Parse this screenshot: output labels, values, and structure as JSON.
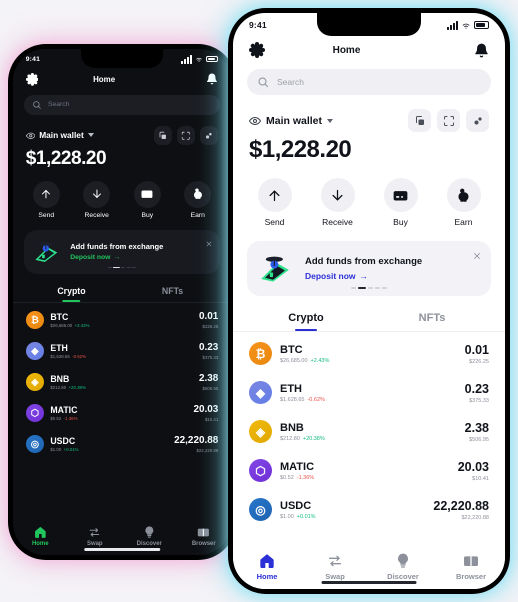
{
  "meta": {
    "accent_dark": "#21c55d",
    "accent_light": "#2a2fd6",
    "up_color": "#13bd7e",
    "down_color": "#e8524b",
    "glow_dark_phone": "#f0a0d2",
    "glow_light_phone": "#78dcf0"
  },
  "status_bar": {
    "time": "9:41",
    "signal_icon": "cellular-bars-icon",
    "wifi_icon": "wifi-icon",
    "battery_icon": "battery-icon"
  },
  "header": {
    "title": "Home",
    "settings_icon": "gear-icon",
    "notifications_icon": "bell-icon"
  },
  "search": {
    "placeholder": "Search",
    "icon": "search-icon"
  },
  "wallet": {
    "eye_icon": "eye-icon",
    "name": "Main wallet",
    "caret_icon": "chevron-down-icon",
    "balance": "$1,228.20",
    "actions": [
      {
        "name": "copy-address-button",
        "icon": "copy-icon"
      },
      {
        "name": "scan-qr-button",
        "icon": "scan-icon"
      },
      {
        "name": "connect-button",
        "icon": "link-icon"
      }
    ]
  },
  "quick_actions": [
    {
      "label": "Send",
      "icon": "arrow-up-icon"
    },
    {
      "label": "Receive",
      "icon": "arrow-down-icon"
    },
    {
      "label": "Buy",
      "icon": "card-icon"
    },
    {
      "label": "Earn",
      "icon": "piggy-bank-icon"
    }
  ],
  "promo": {
    "title": "Add funds from exchange",
    "cta": "Deposit now",
    "cta_arrow": "→",
    "close_icon": "close-icon",
    "illustration": "phone-with-coin-icon",
    "dots": 5,
    "active_dot": 1
  },
  "tabs": [
    {
      "label": "Crypto",
      "active": true
    },
    {
      "label": "NFTs",
      "active": false
    }
  ],
  "tokens": [
    {
      "symbol": "BTC",
      "price": "$26,685.00",
      "change": "+2.43%",
      "dir": "up",
      "amount": "0.01",
      "value": "$226.25",
      "color1": "#f7931a",
      "color2": "#e8870f",
      "glyph": "₿"
    },
    {
      "symbol": "ETH",
      "price": "$1,628.65",
      "change": "-0.62%",
      "dir": "down",
      "amount": "0.23",
      "value": "$375.33",
      "color1": "#7b86e0",
      "color2": "#627ee8",
      "glyph": "◆"
    },
    {
      "symbol": "BNB",
      "price": "$212.80",
      "change": "+20.38%",
      "dir": "up",
      "amount": "2.38",
      "value": "$506.95",
      "color1": "#f0b90b",
      "color2": "#e0a800",
      "glyph": "◈"
    },
    {
      "symbol": "MATIC",
      "price": "$0.52",
      "change": "-1.36%",
      "dir": "down",
      "amount": "20.03",
      "value": "$10.41",
      "color1": "#8247e5",
      "color2": "#6f2fd6",
      "glyph": "⬡"
    },
    {
      "symbol": "USDC",
      "price": "$1.00",
      "change": "+0.01%",
      "dir": "up",
      "amount": "22,220.88",
      "value": "$22,220.88",
      "color1": "#2775ca",
      "color2": "#1f63b0",
      "glyph": "◎"
    }
  ],
  "bottom_nav": [
    {
      "label": "Home",
      "icon": "home-icon",
      "active": true
    },
    {
      "label": "Swap",
      "icon": "swap-icon",
      "active": false
    },
    {
      "label": "Discover",
      "icon": "bulb-icon",
      "active": false
    },
    {
      "label": "Browser",
      "icon": "browser-icon",
      "active": false
    }
  ]
}
